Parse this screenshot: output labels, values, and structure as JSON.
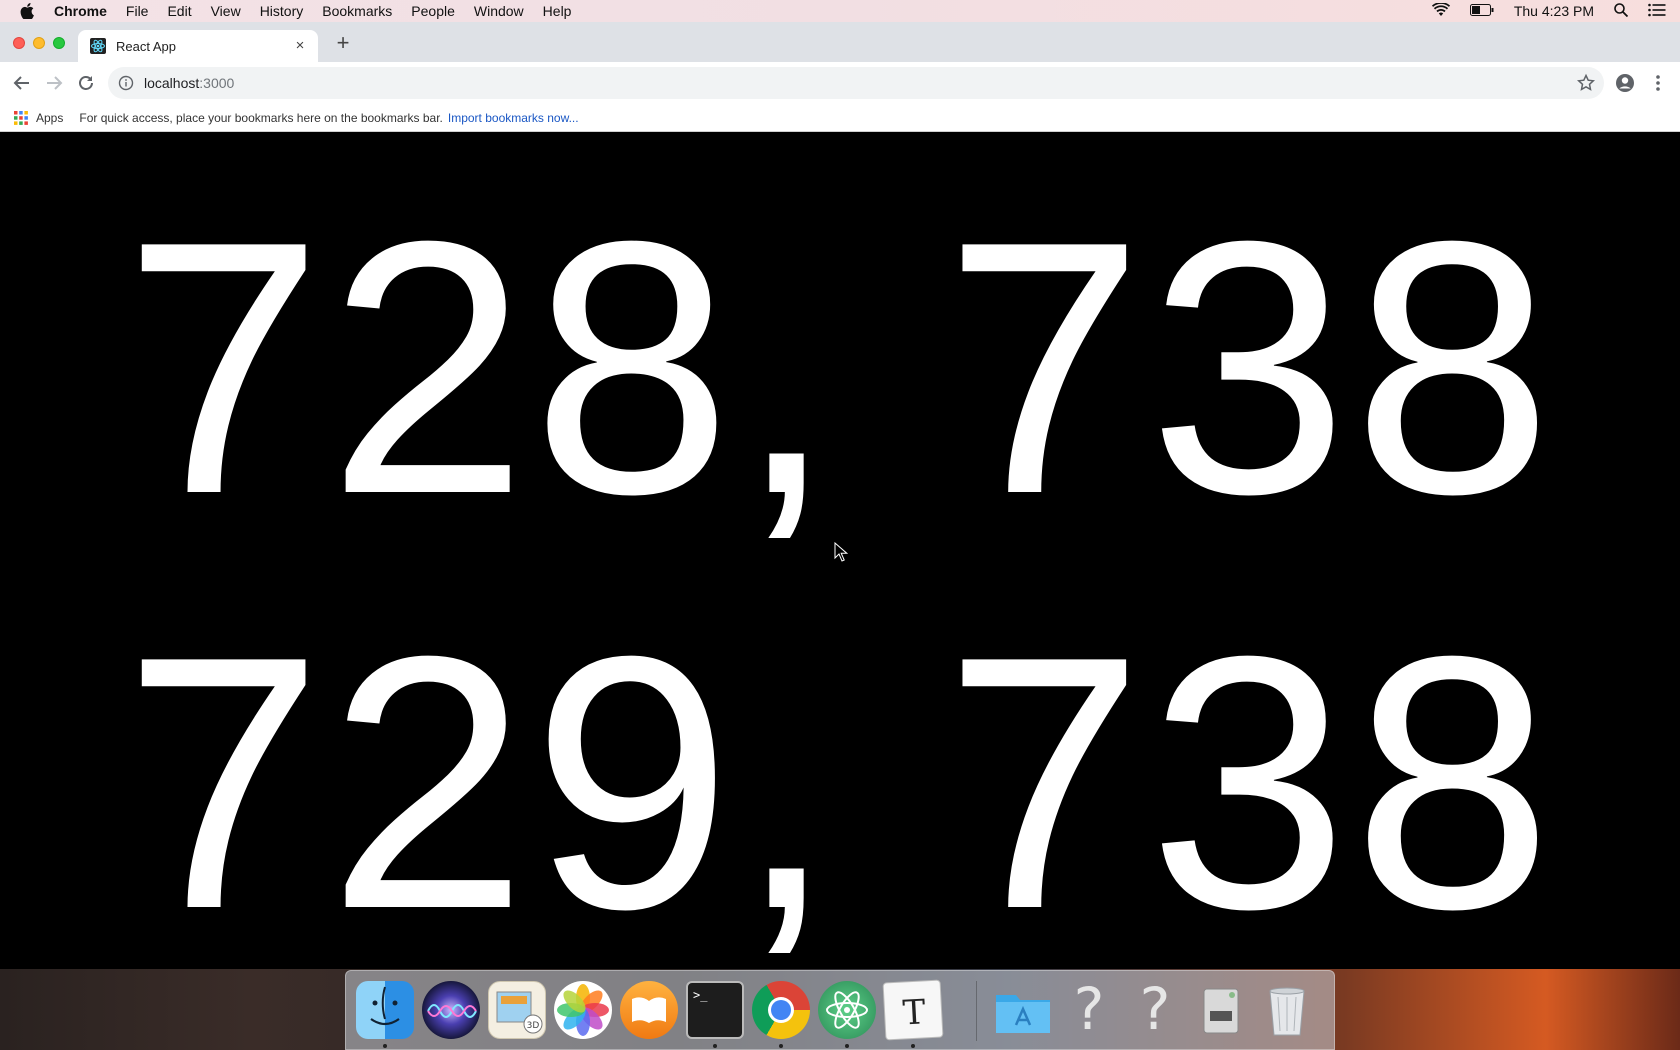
{
  "menubar": {
    "app_name": "Chrome",
    "items": [
      "File",
      "Edit",
      "View",
      "History",
      "Bookmarks",
      "People",
      "Window",
      "Help"
    ],
    "clock": "Thu 4:23 PM"
  },
  "tab": {
    "title": "React App",
    "close_glyph": "×",
    "new_tab_glyph": "+"
  },
  "omnibox": {
    "host": "localhost",
    "port": ":3000"
  },
  "bookmarks": {
    "apps_label": "Apps",
    "hint": "For quick access, place your bookmarks here on the bookmarks bar.",
    "import_link": "Import bookmarks now..."
  },
  "content": {
    "line1": "728, 738",
    "line2": "729, 738"
  },
  "dock": {
    "unknown_app_glyph": "?",
    "icons": [
      "finder-icon",
      "siri-icon",
      "calendar-preview-icon",
      "photos-icon",
      "ibooks-icon",
      "terminal-icon",
      "chrome-icon",
      "atom-icon",
      "typora-icon",
      "applications-folder-icon",
      "unknown-app-icon",
      "unknown-app-icon",
      "disk-utility-icon",
      "trash-icon"
    ]
  },
  "colors": {
    "page_background": "#000000",
    "page_text": "#ffffff",
    "link": "#1a57c4"
  }
}
